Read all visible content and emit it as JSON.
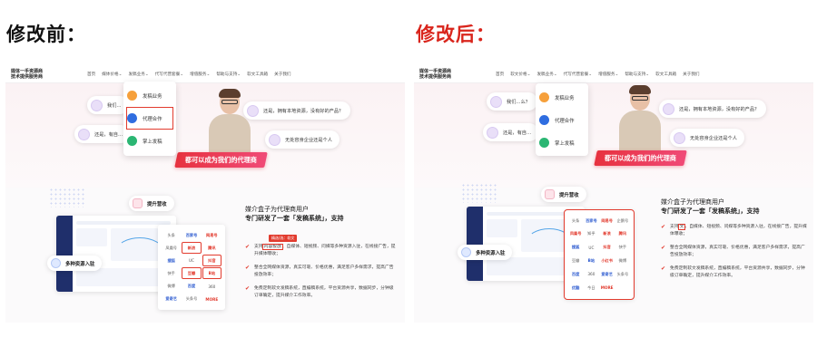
{
  "labels": {
    "before": "修改前：",
    "after": "修改后：",
    "before_color": "#111111",
    "after_color": "#d9251c"
  },
  "site": {
    "logo_line1": "媒体一手资源商",
    "logo_line2": "技术提供服务商",
    "nav_before": [
      "首页",
      "媒体价格⌄",
      "发稿业务⌄",
      "代写代营套餐⌄",
      "增值服务⌄",
      "帮助与支持⌄",
      "软文工具箱",
      "关于我们"
    ],
    "nav_after": [
      "首页",
      "软文价格⌄",
      "发稿业务⌄",
      "代写代营套餐⌄",
      "增值服务⌄",
      "帮助与支持⌄",
      "软文工具箱",
      "关于我们"
    ]
  },
  "dropdown": {
    "items": [
      "发稿业务",
      "代理合作",
      "掌上发稿"
    ]
  },
  "dropdown_after": {
    "items": [
      "发稿业务",
      "代理合作",
      "掌上发稿"
    ]
  },
  "bubbles": {
    "b1_before": "我们…",
    "b1_after": "我们…么？",
    "b2": "还是，有自…",
    "b3": "还是，拥有本地资源，没有好的产品？",
    "b4": "无处容身企业还是个人"
  },
  "banner": "都可以成为我们的代理商",
  "tags": {
    "growth": "提升营收",
    "resources": "多种资源入驻"
  },
  "grid_cells": [
    "头条",
    "百家号",
    "网易号",
    "企鹅号",
    "凤凰号",
    "知乎",
    "新浪",
    "腾讯",
    "搜狐",
    "UC",
    "抖音",
    "快手",
    "豆瓣",
    "B站",
    "小红书",
    "微博",
    "百度",
    "360",
    "爱奇艺",
    "头条号",
    "优酷",
    "今日",
    "MORE",
    ""
  ],
  "copy": {
    "title": "媒介盒子为代理商用户",
    "subtitle": "专门研发了一套「发稿系统」，支持",
    "badge": "精选/选：软文",
    "item1_pre": "支持",
    "item1_hl": "内容投放",
    "item1_hl_after": "文",
    "item1_post": "、自媒体、短视频、问媒等多种资源入驻，在线接广告，提升媒体曝收；",
    "item2": "整合全网媒体资源，真实可靠、价格优惠，满足客户多样需求，提高广告投放效率；",
    "item3": "免费定制软文发稿系统，直编稿系统，平台资源共享，数据同步，分钟级订单确定，提升媒介工作效率。"
  }
}
